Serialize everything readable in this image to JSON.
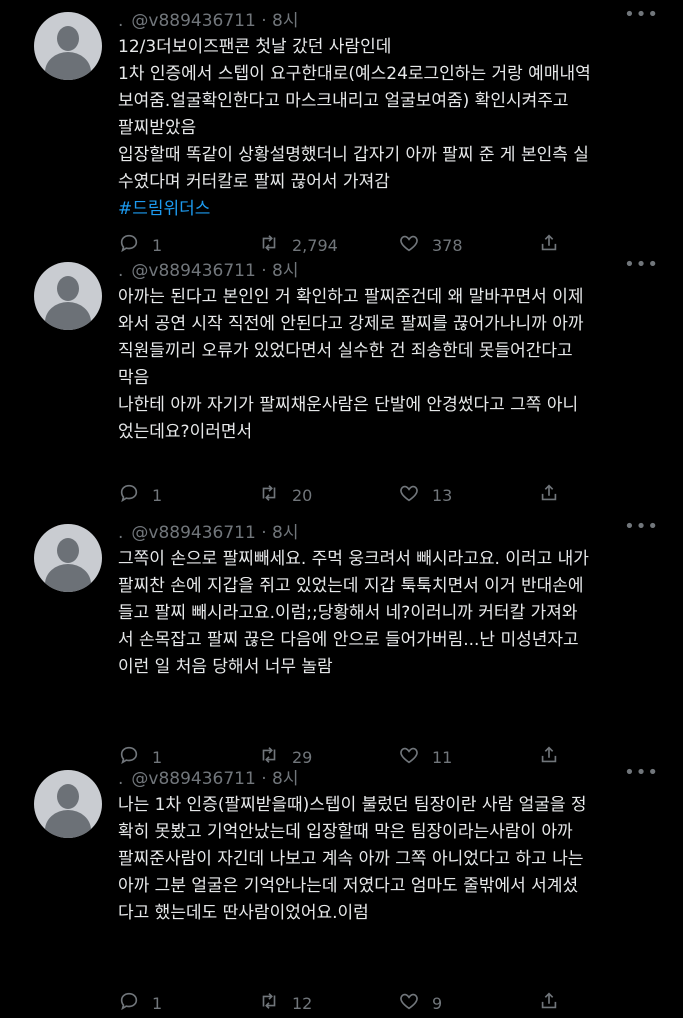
{
  "tweets": [
    {
      "handle": "@v889436711",
      "time": "8시",
      "lines": [
        "12/3더보이즈팬콘 첫날 갔던 사람인데",
        "1차 인증에서 스텝이 요구한대로(예스24로그인하는 거랑 예매내역",
        "보여줌.얼굴확인한다고 마스크내리고 얼굴보여줌) 확인시켜주고",
        "팔찌받았음",
        "입장할때 똑같이 상황설명했더니 갑자기 아까 팔찌 준 게 본인측 실",
        "수였다며 커터칼로 팔찌 끊어서 가져감"
      ],
      "hashtag": "#드림위더스",
      "replies": "1",
      "retweets": "2,794",
      "likes": "378"
    },
    {
      "handle": "@v889436711",
      "time": "8시",
      "lines": [
        "아까는 된다고 본인인 거 확인하고 팔찌준건데 왜 말바꾸면서 이제",
        "와서 공연 시작 직전에 안된다고 강제로 팔찌를 끊어가나니까 아까",
        "직원들끼리 오류가 있었다면서 실수한 건 죄송한데 못들어간다고",
        "막음",
        "나한테 아까 자기가 팔찌채운사람은 단발에 안경썼다고 그쪽 아니",
        "었는데요?이러면서"
      ],
      "hashtag": "",
      "replies": "1",
      "retweets": "20",
      "likes": "13"
    },
    {
      "handle": "@v889436711",
      "time": "8시",
      "lines": [
        "그쪽이 손으로 팔찌빼세요. 주먹 웅크려서 빼시라고요. 이러고 내가",
        "팔찌찬 손에 지갑을 쥐고 있었는데 지갑 툭툭치면서 이거 반대손에",
        "들고 팔찌 빼시라고요.이럼;;당황해서 네?이러니까 커터칼 가져와",
        "서 손목잡고 팔찌 끊은 다음에 안으로 들어가버림...난 미성년자고",
        "이런 일 처음 당해서 너무 놀람"
      ],
      "hashtag": "",
      "replies": "1",
      "retweets": "29",
      "likes": "11"
    },
    {
      "handle": "@v889436711",
      "time": "8시",
      "lines": [
        "나는 1차 인증(팔찌받을때)스텝이 불렀던 팀장이란 사람 얼굴을 정",
        "확히 못봤고 기억안났는데 입장할때 막은 팀장이라는사람이 아까",
        "팔찌준사람이 자긴데 나보고 계속 아까 그쪽 아니었다고 하고 나는",
        "아까 그분 얼굴은 기억안나는데 저였다고 엄마도 줄밖에서 서계셨",
        "다고 했는데도 딴사람이었어요.이럼"
      ],
      "hashtag": "",
      "replies": "1",
      "retweets": "12",
      "likes": "9"
    }
  ]
}
